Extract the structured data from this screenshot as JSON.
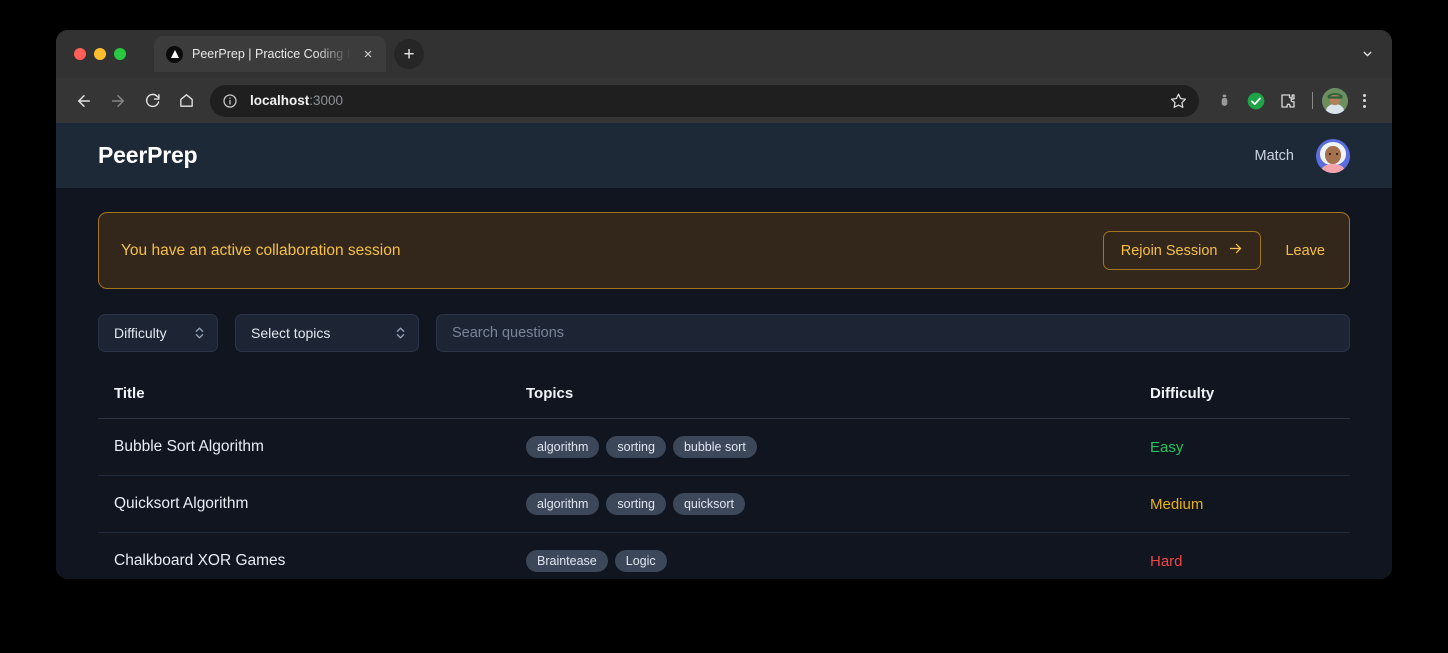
{
  "browser": {
    "tab": {
      "title": "PeerPrep | Practice Coding In",
      "favicon_name": "nextjs-triangle-icon",
      "close_label": "×"
    },
    "new_tab_label": "+",
    "tabstrip_chevron": "⌄",
    "nav": {
      "back": "←",
      "forward": "→",
      "reload": "↻",
      "home": "⌂"
    },
    "omnibox": {
      "host": "localhost",
      "port": ":3000",
      "site_info_icon": "info-circle-icon",
      "star_icon": "bookmark-star-icon"
    },
    "toolbar_icons": [
      "extension-small-icon",
      "check-circle-green-icon",
      "extensions-puzzle-icon",
      "profile-avatar-icon",
      "three-dot-menu-icon"
    ],
    "colors": {
      "tabstrip": "#323232",
      "toolbar": "#353535",
      "omnibox": "#1f1f1f",
      "check_green": "#1ea446"
    }
  },
  "app": {
    "header": {
      "brand": "PeerPrep",
      "match_label": "Match",
      "avatar_name": "user-avatar"
    },
    "banner": {
      "message": "You have an active collaboration session",
      "rejoin_label": "Rejoin Session",
      "rejoin_arrow": "→",
      "leave_label": "Leave",
      "accent": "#f4c04a",
      "border": "#a1741e",
      "background": "#33271c"
    },
    "filters": {
      "difficulty_label": "Difficulty",
      "topics_label": "Select topics",
      "search_placeholder": "Search questions"
    },
    "table": {
      "columns": [
        "Title",
        "Topics",
        "Difficulty"
      ],
      "rows": [
        {
          "title": "Bubble Sort Algorithm",
          "topics": [
            "algorithm",
            "sorting",
            "bubble sort"
          ],
          "difficulty": "Easy",
          "difficulty_color": "#22c55e"
        },
        {
          "title": "Quicksort Algorithm",
          "topics": [
            "algorithm",
            "sorting",
            "quicksort"
          ],
          "difficulty": "Medium",
          "difficulty_color": "#eab308"
        },
        {
          "title": "Chalkboard XOR Games",
          "topics": [
            "Braintease",
            "Logic"
          ],
          "difficulty": "Hard",
          "difficulty_color": "#ef4444"
        }
      ]
    },
    "colors": {
      "page_bg": "#10151f",
      "header_bg": "#1e2937",
      "field_bg": "#1d2534",
      "tag_bg": "#3c4759"
    }
  }
}
